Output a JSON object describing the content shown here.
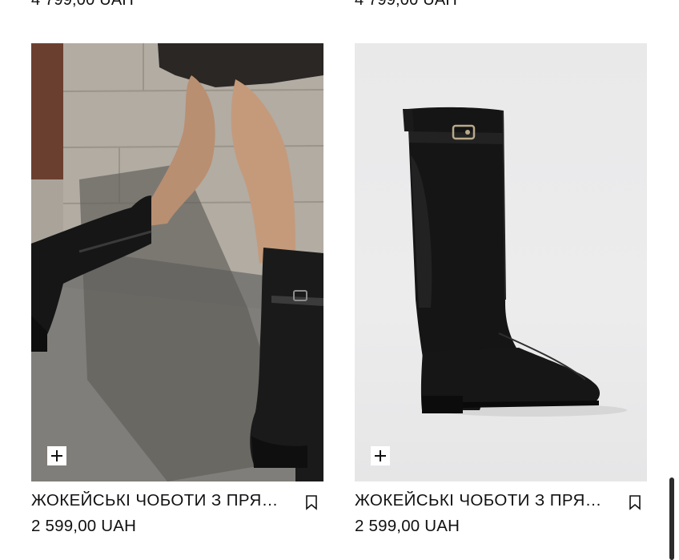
{
  "previous_row": {
    "left_price": "4 799,00 UAH",
    "right_price": "4 799,00 UAH"
  },
  "products": [
    {
      "name": "ЖОКЕЙСЬКІ ЧОБОТИ З ПРЯ…",
      "price": "2 599,00 UAH",
      "image": "model-walking-in-black-riding-boots",
      "add_icon": "plus-icon",
      "save_icon": "bookmark-icon"
    },
    {
      "name": "ЖОКЕЙСЬКІ ЧОБОТИ З ПРЯ…",
      "price": "2 599,00 UAH",
      "image": "black-riding-boot-studio",
      "add_icon": "plus-icon",
      "save_icon": "bookmark-icon"
    }
  ]
}
